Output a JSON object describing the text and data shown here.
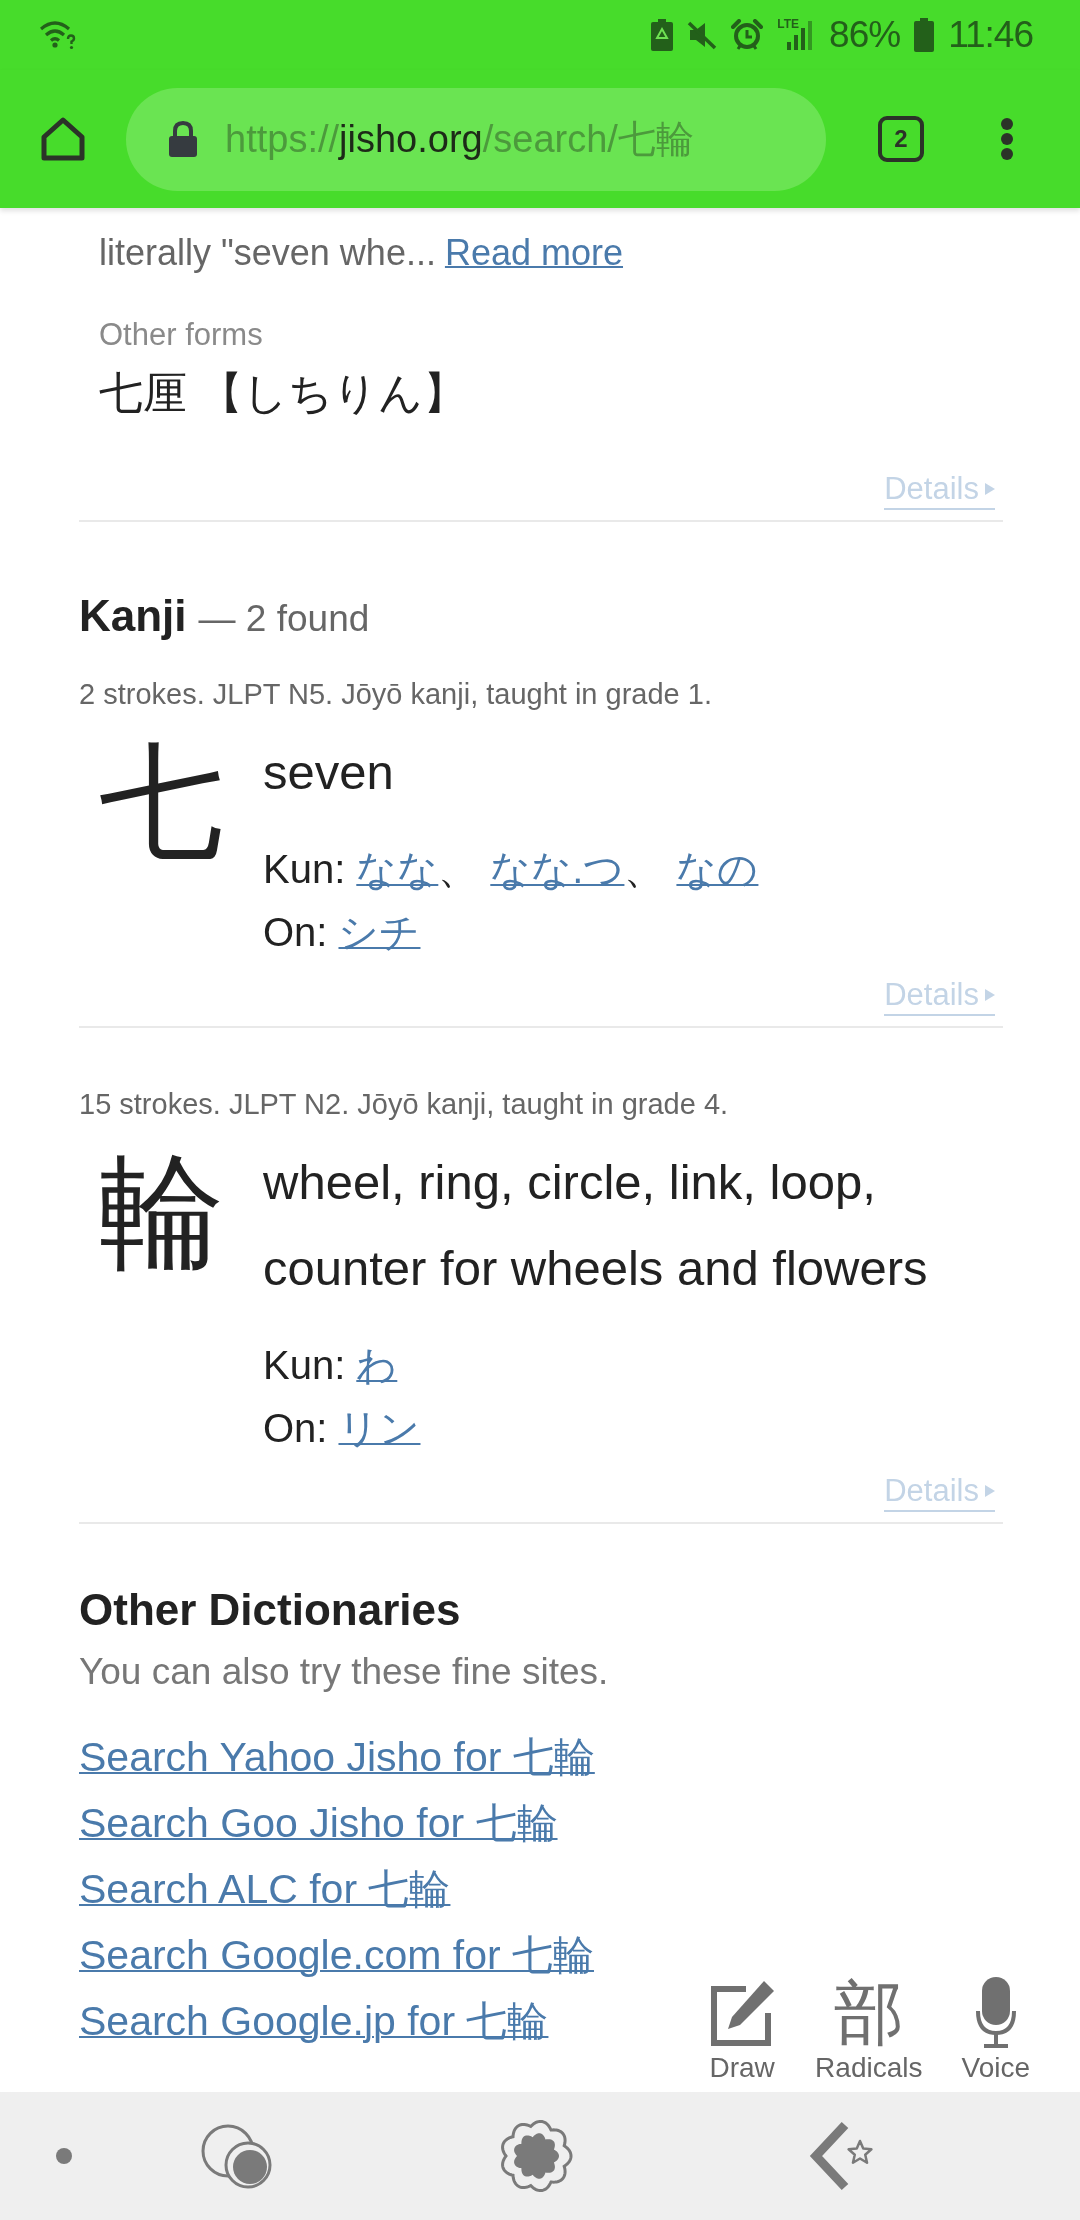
{
  "status_bar": {
    "network": "LTE",
    "battery": "86%",
    "time": "11:46"
  },
  "browser_toolbar": {
    "url": {
      "scheme": "https://",
      "host": "jisho.org",
      "path": "/search/七輪"
    },
    "tab_count": "2"
  },
  "word_entry": {
    "note": "literally \"seven whe...",
    "read_more": "Read more",
    "other_forms_label": "Other forms",
    "other_forms": "七厘 【しちりん】",
    "details": "Details"
  },
  "kanji_section": {
    "title": "Kanji",
    "count": "— 2 found",
    "items": [
      {
        "character": "七",
        "info": "2 strokes. JLPT N5. Jōyō kanji, taught in grade 1.",
        "meanings": "seven",
        "kun_label": "Kun:",
        "kun": [
          {
            "reading": "なな",
            "separator": "、"
          },
          {
            "reading": "なな.つ",
            "separator": "、"
          },
          {
            "reading": "なの"
          }
        ],
        "on_label": "On:",
        "on": [
          {
            "reading": "シチ"
          }
        ],
        "details": "Details"
      },
      {
        "character": "輪",
        "info": "15 strokes. JLPT N2. Jōyō kanji, taught in grade 4.",
        "meanings": "wheel, ring, circle, link, loop, counter for wheels and flowers",
        "kun_label": "Kun:",
        "kun": [
          {
            "reading": "わ"
          }
        ],
        "on_label": "On:",
        "on": [
          {
            "reading": "リン"
          }
        ],
        "details": "Details"
      }
    ]
  },
  "other_dictionaries": {
    "title": "Other Dictionaries",
    "subtitle": "You can also try these fine sites.",
    "links": [
      "Search Yahoo Jisho for 七輪",
      "Search Goo Jisho for 七輪",
      "Search ALC for 七輪",
      "Search Google.com for 七輪",
      "Search Google.jp for 七輪"
    ]
  },
  "input_tools": [
    {
      "kind": "draw",
      "label": "Draw"
    },
    {
      "kind": "radicals",
      "glyph": "部",
      "label": "Radicals"
    },
    {
      "kind": "voice",
      "label": "Voice"
    }
  ]
}
